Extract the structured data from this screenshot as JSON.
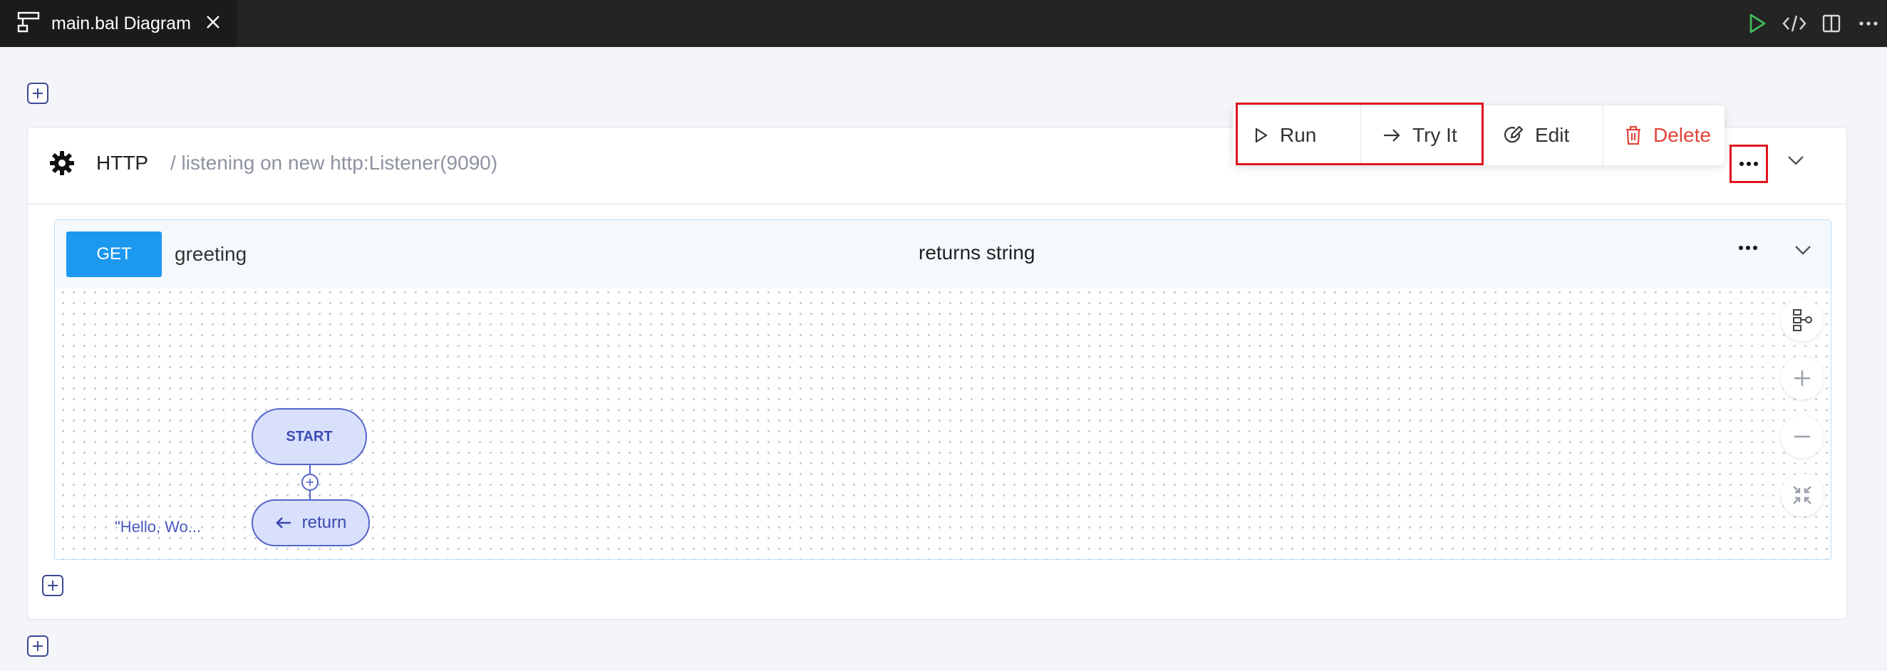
{
  "tab": {
    "title": "main.bal Diagram",
    "icon": "diagram-icon",
    "close": "✕"
  },
  "service": {
    "type": "HTTP",
    "listener": "/ listening on new http:Listener(9090)"
  },
  "menu": {
    "run": "Run",
    "try_it": "Try It",
    "edit": "Edit",
    "delete": "Delete"
  },
  "resource": {
    "method": "GET",
    "name": "greeting",
    "returns": "returns string"
  },
  "diagram": {
    "start": "START",
    "return": "return",
    "return_value": "\"Hello, Wo..."
  },
  "colors": {
    "accent": "#1c98ef",
    "node_fill": "#d9e0fb",
    "node_stroke": "#5465c9",
    "delete": "#e0453a",
    "highlight": "#e0161e"
  }
}
